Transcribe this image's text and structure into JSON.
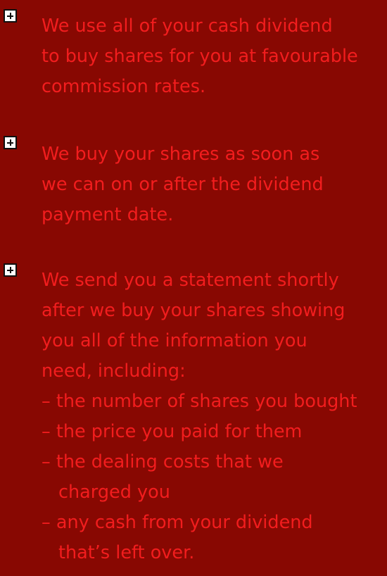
{
  "colors": {
    "background": "#880802",
    "text": "#f21d1e",
    "icon_fill": "#ffffff",
    "icon_stroke": "#111111"
  },
  "items": [
    {
      "icon": "plus-box-icon",
      "lines": [
        "We use all of your cash dividend",
        "to buy shares for you at favourable",
        "commission rates."
      ]
    },
    {
      "icon": "plus-box-icon",
      "lines": [
        "We buy your shares as soon as",
        "we can on or after the dividend",
        "payment date."
      ]
    },
    {
      "icon": "plus-box-icon",
      "lines": [
        "We send you a statement shortly",
        "after we buy your shares showing",
        "you all of the information you",
        "need, including:"
      ],
      "subitems": [
        {
          "lines": [
            "– the number of shares you bought"
          ]
        },
        {
          "lines": [
            "– the price you paid for them"
          ]
        },
        {
          "lines": [
            "– the dealing costs that we",
            "charged you"
          ]
        },
        {
          "lines": [
            "– any cash from your dividend",
            "that’s left over."
          ]
        }
      ]
    }
  ]
}
